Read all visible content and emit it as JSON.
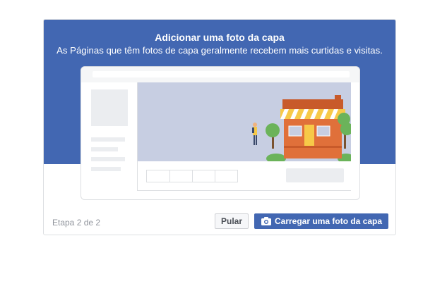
{
  "dialog": {
    "title": "Adicionar uma foto da capa",
    "subtitle": "As Páginas que têm fotos de capa geralmente recebem mais curtidas e visitas.",
    "illustration_icon": "storefront-illustration",
    "step": "Etapa 2 de 2",
    "skip_label": "Pular",
    "upload_label": "Carregar uma foto da capa",
    "upload_icon": "camera-icon"
  },
  "colors": {
    "brand": "#4267b2",
    "cover_placeholder": "#c7cee2",
    "store_orange": "#e0703a",
    "awning_yellow": "#f7c948",
    "tree_green": "#6bb35a"
  }
}
